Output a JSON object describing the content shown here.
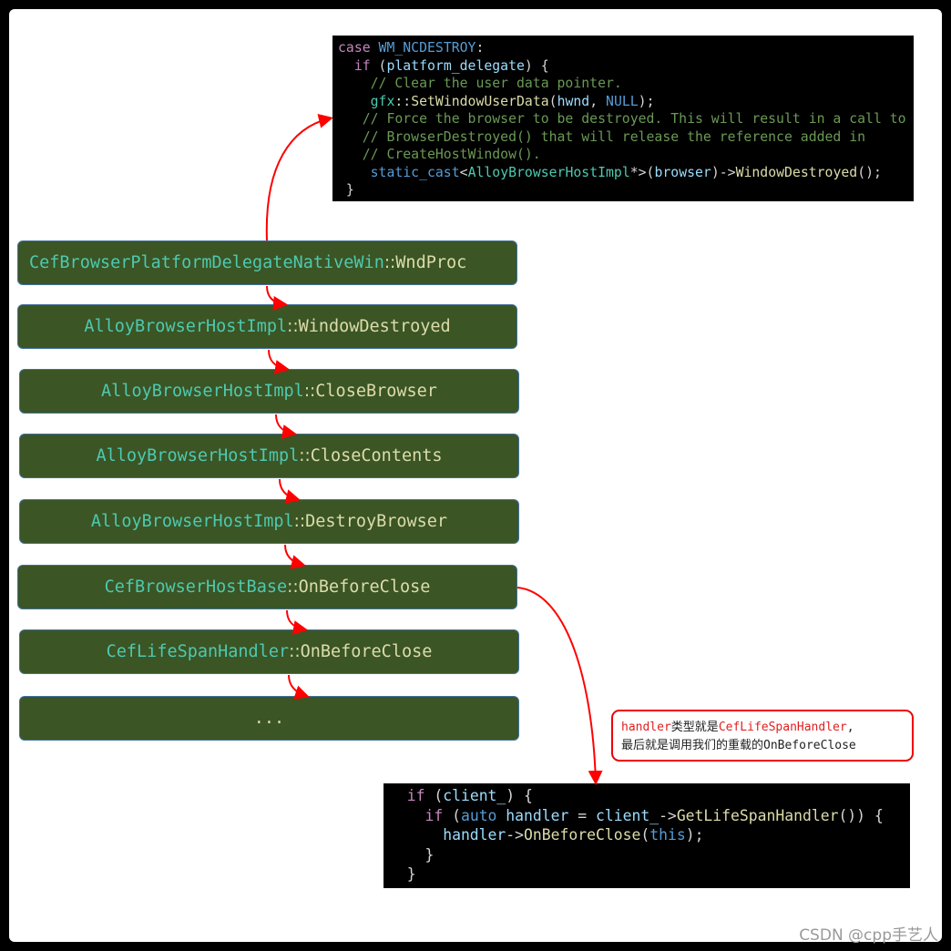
{
  "call_chain": [
    {
      "cls": "CefBrowserPlatformDelegateNativeWin",
      "sep": "::",
      "fn": "WndProc"
    },
    {
      "cls": "AlloyBrowserHostImpl",
      "sep": "::",
      "fn": "WindowDestroyed"
    },
    {
      "cls": "AlloyBrowserHostImpl",
      "sep": "::",
      "fn": "CloseBrowser"
    },
    {
      "cls": "AlloyBrowserHostImpl",
      "sep": "::",
      "fn": "CloseContents"
    },
    {
      "cls": "AlloyBrowserHostImpl",
      "sep": "::",
      "fn": "DestroyBrowser"
    },
    {
      "cls": "CefBrowserHostBase",
      "sep": "::",
      "fn": "OnBeforeClose"
    },
    {
      "cls": "CefLifeSpanHandler",
      "sep": "::",
      "fn": "OnBeforeClose"
    },
    {
      "cls": "",
      "sep": "",
      "fn": "..."
    }
  ],
  "code_top": [
    [
      {
        "t": "case ",
        "c": "k"
      },
      {
        "t": "WM_NCDESTROY",
        "c": "b"
      },
      {
        "t": ":",
        "c": "p"
      }
    ],
    [
      {
        "t": "  if ",
        "c": "k"
      },
      {
        "t": "(",
        "c": "p"
      },
      {
        "t": "platform_delegate",
        "c": "v"
      },
      {
        "t": ") {",
        "c": "p"
      }
    ],
    [
      {
        "t": "    // Clear the user data pointer.",
        "c": "c"
      }
    ],
    [
      {
        "t": "    gfx",
        "c": "t"
      },
      {
        "t": "::",
        "c": "p"
      },
      {
        "t": "SetWindowUserData",
        "c": "f"
      },
      {
        "t": "(",
        "c": "p"
      },
      {
        "t": "hwnd",
        "c": "v"
      },
      {
        "t": ", ",
        "c": "p"
      },
      {
        "t": "NULL",
        "c": "b"
      },
      {
        "t": ");",
        "c": "p"
      }
    ],
    [
      {
        "t": "   // Force the browser to be destroyed. This will result in a call to",
        "c": "c"
      }
    ],
    [
      {
        "t": "   // BrowserDestroyed() that will release the reference added in",
        "c": "c"
      }
    ],
    [
      {
        "t": "   // CreateHostWindow().",
        "c": "c"
      }
    ],
    [
      {
        "t": "    static_cast",
        "c": "b"
      },
      {
        "t": "<",
        "c": "p"
      },
      {
        "t": "AlloyBrowserHostImpl",
        "c": "t"
      },
      {
        "t": "*>(",
        "c": "p"
      },
      {
        "t": "browser",
        "c": "v"
      },
      {
        "t": ")->",
        "c": "p"
      },
      {
        "t": "WindowDestroyed",
        "c": "f"
      },
      {
        "t": "();",
        "c": "p"
      }
    ],
    [
      {
        "t": " }",
        "c": "p"
      }
    ]
  ],
  "code_bottom": [
    [
      {
        "t": "  if ",
        "c": "k"
      },
      {
        "t": "(",
        "c": "p"
      },
      {
        "t": "client_",
        "c": "v"
      },
      {
        "t": ") {",
        "c": "p"
      }
    ],
    [
      {
        "t": "    if ",
        "c": "k"
      },
      {
        "t": "(",
        "c": "p"
      },
      {
        "t": "auto ",
        "c": "b"
      },
      {
        "t": "handler",
        "c": "v"
      },
      {
        "t": " = ",
        "c": "p"
      },
      {
        "t": "client_",
        "c": "v"
      },
      {
        "t": "->",
        "c": "p"
      },
      {
        "t": "GetLifeSpanHandler",
        "c": "f"
      },
      {
        "t": "()) {",
        "c": "p"
      }
    ],
    [
      {
        "t": "      handler",
        "c": "v"
      },
      {
        "t": "->",
        "c": "p"
      },
      {
        "t": "OnBeforeClose",
        "c": "f"
      },
      {
        "t": "(",
        "c": "p"
      },
      {
        "t": "this",
        "c": "b"
      },
      {
        "t": ");",
        "c": "p"
      }
    ],
    [
      {
        "t": "    }",
        "c": "p"
      }
    ],
    [
      {
        "t": "  }",
        "c": "p"
      }
    ]
  ],
  "callout": {
    "line1_a": "handler",
    "line1_b": "类型就是",
    "line1_c": "CefLifeSpanHandler",
    "line1_d": ",",
    "line2": "最后就是调用我们的重载的OnBeforeClose"
  },
  "watermark": "CSDN @cpp手艺人",
  "colors": {
    "box_fill": "#3b5525",
    "arrow": "#ff0000",
    "callout_border": "#e00000"
  }
}
